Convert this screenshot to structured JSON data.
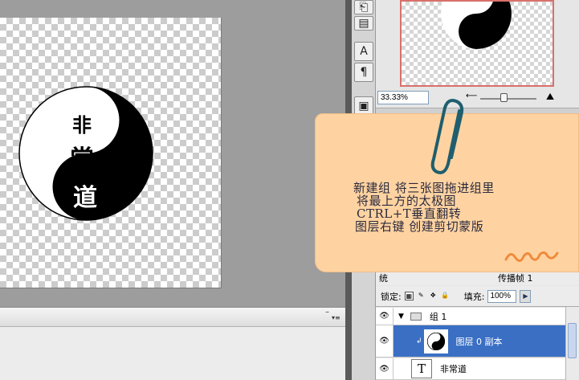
{
  "nav": {
    "zoom": "33.33%"
  },
  "layers": {
    "lock_label": "锁定:",
    "fill_label": "填充:",
    "fill_value": "100%",
    "opt_partial": "统",
    "opt_right": "传播帧 1",
    "items": [
      {
        "name": "组 1",
        "type": "group"
      },
      {
        "name": "图层 0 副本",
        "type": "layer",
        "selected": true
      },
      {
        "name": "非常道",
        "type": "text",
        "thumb": "T"
      }
    ]
  },
  "canvas_art": {
    "chars": [
      "非",
      "常",
      "道"
    ]
  },
  "note": {
    "lines": [
      "新建组   将三张图拖进组里",
      "将最上方的太极图",
      "CTRL+T垂直翻转",
      "图层右键   创建剪切蒙版"
    ]
  },
  "tools": {
    "text_tool": "A",
    "paragraph_tool": "¶"
  },
  "colors": {
    "selection_blue": "#3a6fc4",
    "note_orange": "#ffd3a1",
    "nav_frame": "#d9706b",
    "squiggle": "#f08a3c",
    "clip_teal": "#1f5e6e"
  }
}
